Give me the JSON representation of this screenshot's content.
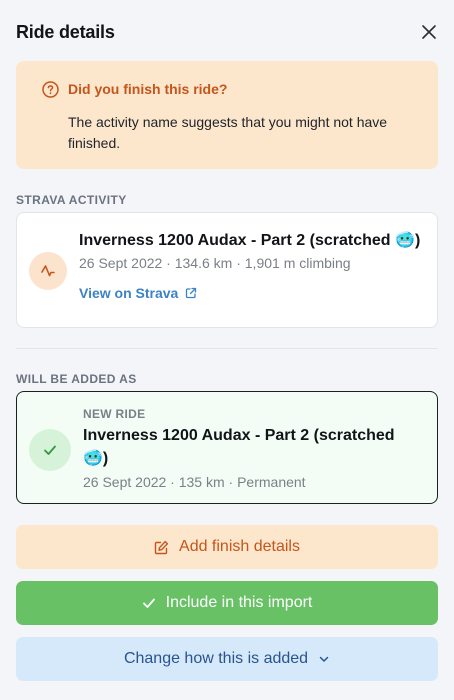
{
  "header": {
    "title": "Ride details"
  },
  "warning": {
    "title": "Did you finish this ride?",
    "text": "The activity name suggests that you might not have finished."
  },
  "strava": {
    "section_label": "STRAVA ACTIVITY",
    "activity_title": "Inverness 1200 Audax - Part 2 (scratched",
    "emoji": "🥶",
    "closing": ")",
    "meta": "26 Sept 2022 · 134.6 km · 1,901 m climbing",
    "link_label": "View on Strava"
  },
  "added": {
    "section_label": "WILL BE ADDED AS",
    "tag": "NEW RIDE",
    "title_line1": "Inverness 1200 Audax - Part 2 (scratched",
    "emoji": "🥶",
    "closing": ")",
    "meta": "26 Sept 2022 · 135 km · Permanent"
  },
  "actions": {
    "finish_label": "Add finish details",
    "include_label": "Include in this import",
    "change_label": "Change how this is added"
  },
  "colors": {
    "warning_bg": "#fce6cc",
    "warning_text": "#c4561c",
    "link": "#3d82c4",
    "success": "#68c265",
    "success_bg": "#f4fdf5",
    "info_bg": "#d6e9fa",
    "info_text": "#27558c"
  }
}
